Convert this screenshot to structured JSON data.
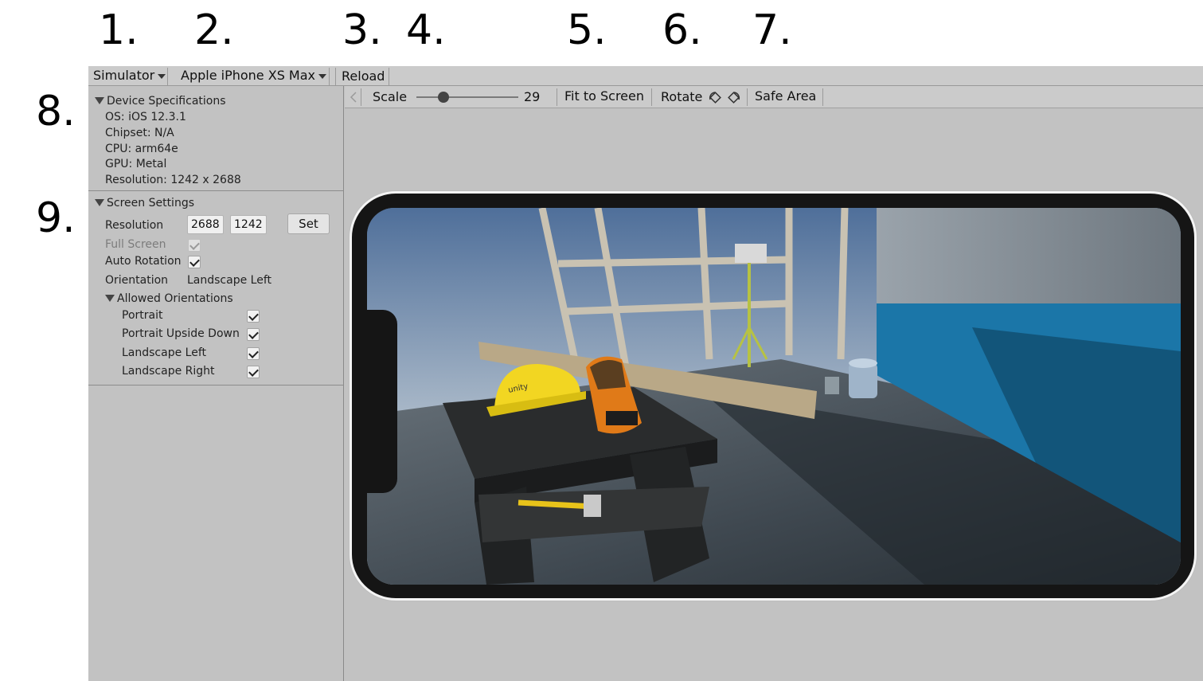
{
  "callouts": [
    "1.",
    "2.",
    "3.",
    "4.",
    "5.",
    "6.",
    "7.",
    "8.",
    "9."
  ],
  "toolbar": {
    "simulator_label": "Simulator",
    "device_label": "Apple iPhone XS Max",
    "reload_label": "Reload"
  },
  "device_specs": {
    "header": "Device Specifications",
    "os": "OS: iOS 12.3.1",
    "chipset": "Chipset: N/A",
    "cpu": "CPU: arm64e",
    "gpu": "GPU: Metal",
    "resolution": "Resolution: 1242 x 2688"
  },
  "screen_settings": {
    "header": "Screen Settings",
    "resolution_label": "Resolution",
    "width_value": "2688",
    "height_value": "1242",
    "set_label": "Set",
    "full_screen_label": "Full Screen",
    "full_screen_checked": true,
    "auto_rotation_label": "Auto Rotation",
    "auto_rotation_checked": true,
    "orientation_label": "Orientation",
    "orientation_value": "Landscape Left",
    "allowed_orientations_header": "Allowed Orientations",
    "allowed": [
      {
        "label": "Portrait",
        "checked": true
      },
      {
        "label": "Portrait Upside Down",
        "checked": true
      },
      {
        "label": "Landscape Left",
        "checked": true
      },
      {
        "label": "Landscape Right",
        "checked": true
      }
    ]
  },
  "view_toolbar": {
    "scale_label": "Scale",
    "scale_value": "29",
    "scale_slider_fraction": 0.24,
    "fit_label": "Fit to Screen",
    "rotate_label": "Rotate",
    "safe_area_label": "Safe Area"
  },
  "game_view": {
    "logo_text": "unity"
  }
}
